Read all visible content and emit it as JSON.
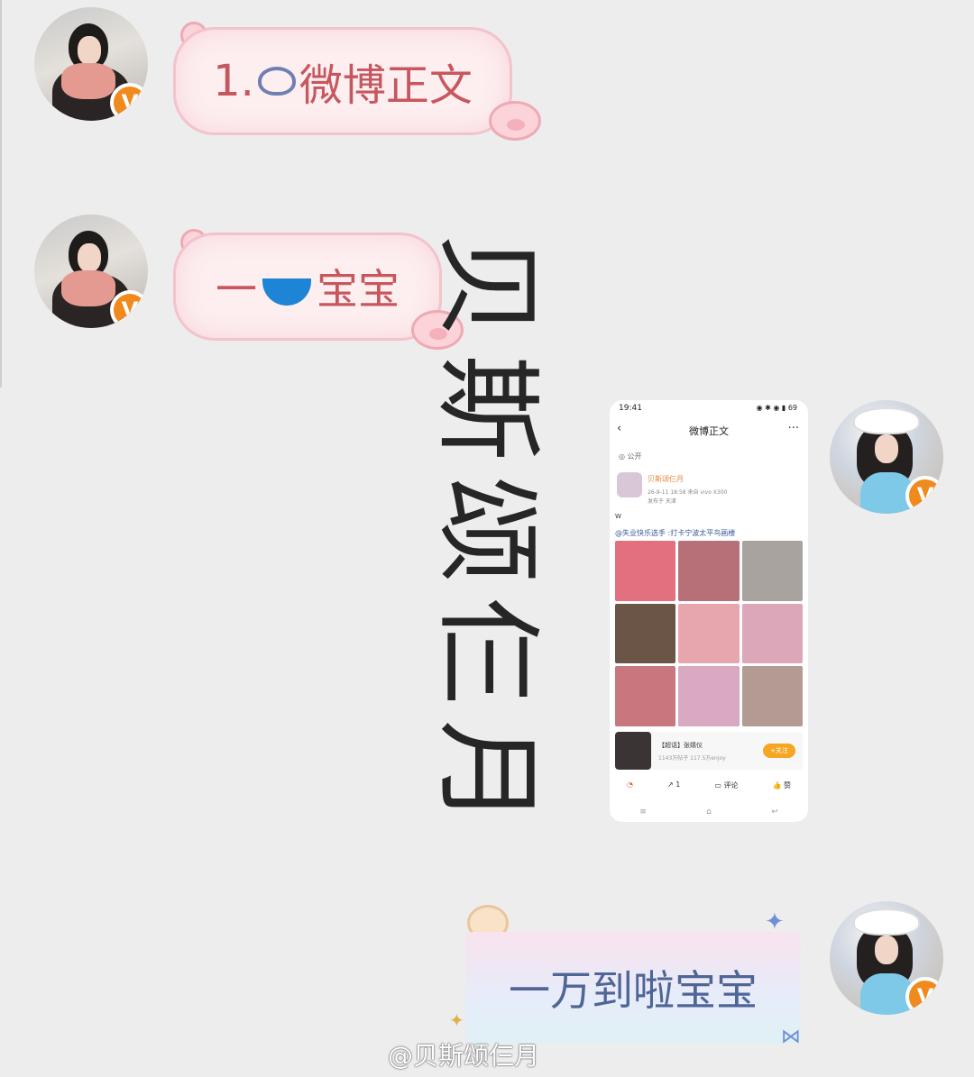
{
  "messages": [
    {
      "side": "left",
      "text_prefix": "1.",
      "icon": "weibo-cloud-icon",
      "text": "微博正文"
    },
    {
      "side": "left",
      "text_prefix": "一",
      "icon": "bowl-icon",
      "text": "宝宝"
    },
    {
      "side": "right",
      "type": "screenshot"
    },
    {
      "side": "right",
      "text": "一万到啦宝宝"
    }
  ],
  "watermark": {
    "chars": [
      "贝",
      "斯",
      "颂",
      "仨",
      "月"
    ]
  },
  "screenshot": {
    "time": "19:41",
    "status_icons": "◉ ✱ ◉ ▮ 69",
    "title": "微博正文",
    "visibility": "公开",
    "username": "贝斯颂仨月",
    "meta": "26-9-11 18:58  来自 vivo X300",
    "location": "发布于 天津",
    "w": "W",
    "post_text": "@失业快乐选手 :打卡宁波太平鸟画楼",
    "topic_title": "【超话】张婧仪",
    "topic_sub": "1143万帖子 117.5万enjoy",
    "topic_button": "+关注",
    "actions": [
      "1",
      "评论",
      "赞"
    ],
    "homebar": [
      "≡",
      "⌂",
      "↩"
    ]
  },
  "footer": {
    "handle": "@贝斯颂仨月"
  },
  "colors": {
    "pink_text": "#c7575e",
    "blue_text": "#4f6596",
    "badge": "#f08a1c"
  }
}
